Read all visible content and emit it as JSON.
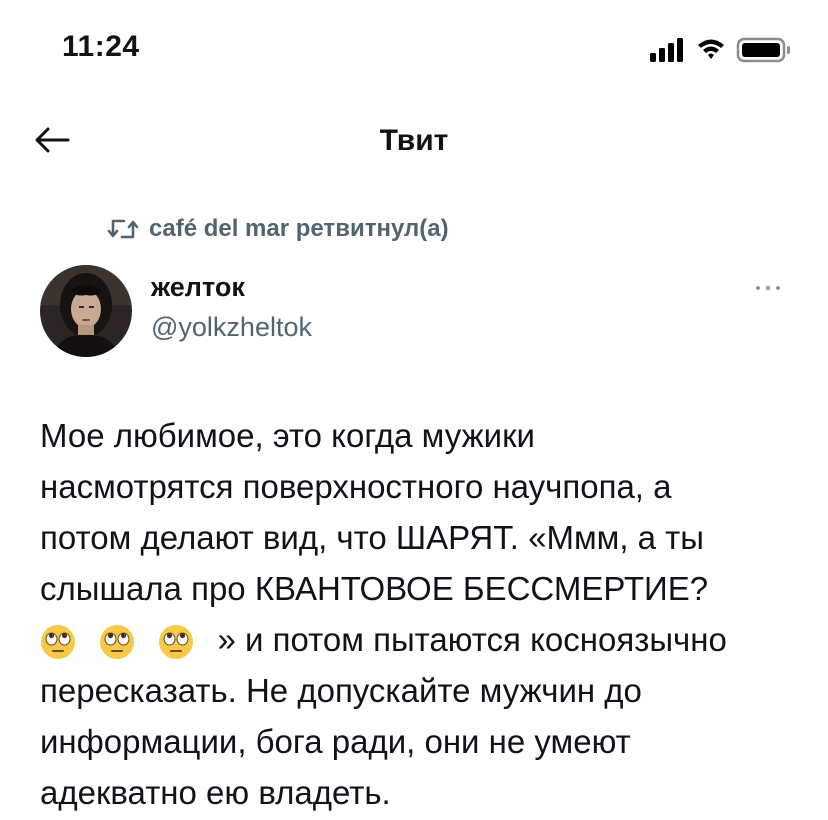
{
  "status_bar": {
    "time": "11:24"
  },
  "header": {
    "title": "Твит"
  },
  "retweet": {
    "text": "café del mar ретвитнул(а)"
  },
  "author": {
    "name": "желток",
    "handle": "@yolkzheltok"
  },
  "tweet": {
    "lines": [
      "Мое любимое, это когда мужики",
      "насмотрятся поверхностного научпопа, а",
      "потом делают вид, что ШАРЯТ. «Ммм, а ты",
      "слышала про КВАНТОВОЕ БЕССМЕРТИЕ?",
      "» и потом пытаются косноязычно",
      "пересказать. Не допускайте мужчин до",
      "информации, бога ради, они не умеют",
      "адекватно ею владеть."
    ],
    "emoji_count_line_5": 3
  },
  "icons": {
    "back": "arrow-left-icon",
    "retweet": "retweet-icon",
    "more": "more-dots-icon",
    "emoji": "face-with-rolling-eyes"
  },
  "colors": {
    "text": "#0f1419",
    "secondary": "#536471"
  }
}
